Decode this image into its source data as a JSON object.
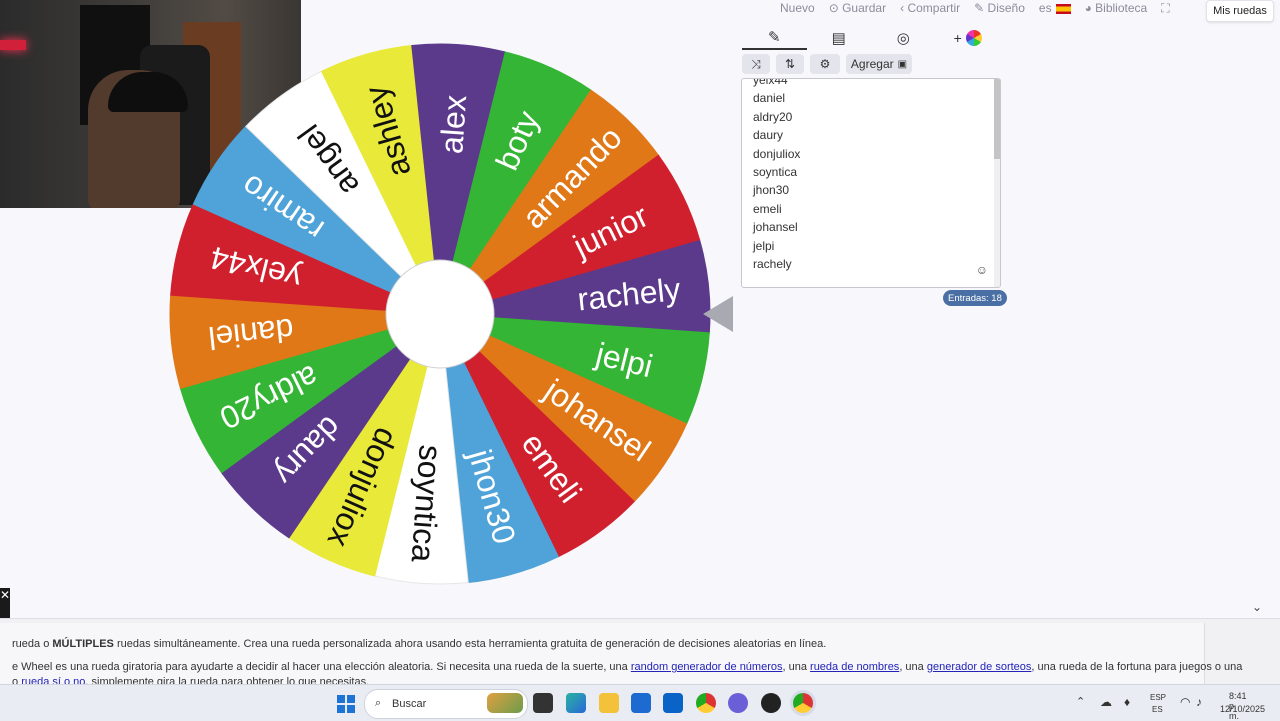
{
  "topbar": {
    "nuevo": "Nuevo",
    "guardar": "Guardar",
    "compartir": "Compartir",
    "diseno": "Diseño",
    "lang": "es",
    "biblioteca": "Biblioteca",
    "mis_ruedas": "Mis ruedas"
  },
  "wheel": {
    "segments": [
      {
        "label": "rachely",
        "color": "#5b3a8c"
      },
      {
        "label": "jelpi",
        "color": "#35b535"
      },
      {
        "label": "johansel",
        "color": "#e07818"
      },
      {
        "label": "emeli",
        "color": "#d0202e"
      },
      {
        "label": "jhon30",
        "color": "#4fa3d8"
      },
      {
        "label": "soyntica",
        "color": "#ffffff"
      },
      {
        "label": "donjuliox",
        "color": "#e9e93a"
      },
      {
        "label": "daury",
        "color": "#5b3a8c"
      },
      {
        "label": "aldry20",
        "color": "#35b535"
      },
      {
        "label": "daniel",
        "color": "#e07818"
      },
      {
        "label": "yelx44",
        "color": "#d0202e"
      },
      {
        "label": "ramiro",
        "color": "#4fa3d8"
      },
      {
        "label": "angel",
        "color": "#ffffff"
      },
      {
        "label": "ashley",
        "color": "#e9e93a"
      },
      {
        "label": "alex",
        "color": "#5b3a8c"
      },
      {
        "label": "boty",
        "color": "#35b535"
      },
      {
        "label": "armando",
        "color": "#e07818"
      },
      {
        "label": "junior",
        "color": "#d0202e"
      }
    ]
  },
  "tools": {
    "agregar": "Agregar"
  },
  "entries": {
    "visible": [
      "yelx44",
      "daniel",
      "aldry20",
      "daury",
      "donjuliox",
      "soyntica",
      "jhon30",
      "emeli",
      "johansel",
      "jelpi",
      "rachely"
    ],
    "count_label": "Entradas: 18"
  },
  "description": {
    "line1_pre": "rueda o ",
    "line1_bold": "MÚLTIPLES",
    "line1_post": " ruedas simultáneamente. Crea una rueda personalizada ahora usando esta herramienta gratuita de generación de decisiones aleatorias en línea.",
    "line2_pre": "e Wheel es una rueda giratoria para ayudarte a decidir al hacer una elección aleatoria. Si necesita una rueda de la suerte, una ",
    "link1": "random generador de números",
    "sep1": ", una ",
    "link2": "rueda de nombres",
    "sep2": ", una ",
    "link3": "generador de sorteos",
    "line2_post": ", una rueda de la fortuna para juegos o una",
    "line3_pre": "o ",
    "link4": "rueda sí o no",
    "line3_post": ", simplemente gira la rueda para obtener lo que necesitas."
  },
  "taskbar": {
    "search": "Buscar",
    "lang_top": "ESP",
    "lang_bottom": "ES",
    "time": "8:41 p. m.",
    "date": "12/10/2025"
  },
  "colors": {
    "accent": "#4a6fa5",
    "link": "#2323b8"
  }
}
